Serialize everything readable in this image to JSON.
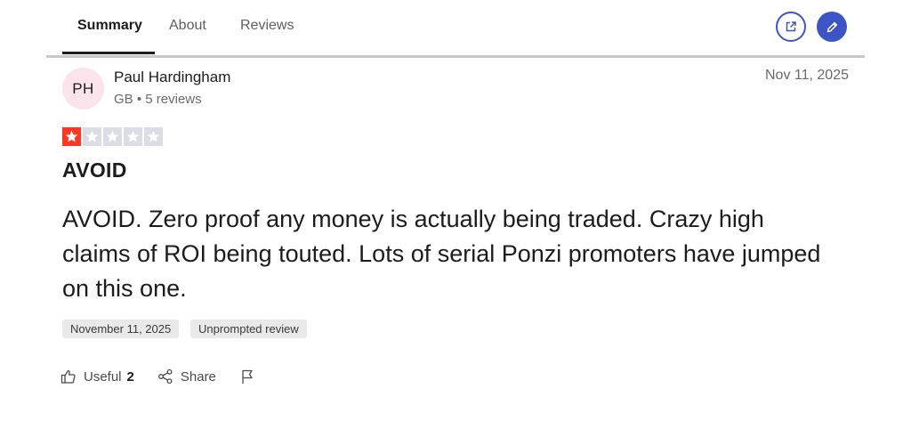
{
  "tabs": [
    {
      "label": "Summary",
      "active": true
    },
    {
      "label": "About",
      "active": false
    },
    {
      "label": "Reviews",
      "active": false
    }
  ],
  "header_actions": {
    "open_external_icon": "external-link-icon",
    "edit_icon": "pencil-icon",
    "accent_color": "#3d55c4"
  },
  "review": {
    "avatar_initials": "PH",
    "author": "Paul Hardingham",
    "author_meta": "GB • 5 reviews",
    "date": "Nov 11, 2025",
    "rating": 1,
    "rating_max": 5,
    "star_color_filled": "#ff3722",
    "star_color_empty": "#dcdce6",
    "title": "AVOID",
    "body": "AVOID. Zero proof any money is actually being traded. Crazy high claims of ROI being touted. Lots of serial Ponzi promoters have jumped on this one.",
    "tags": [
      "November 11, 2025",
      "Unprompted review"
    ],
    "actions": {
      "useful_label": "Useful",
      "useful_count": "2",
      "share_label": "Share",
      "report_icon": "flag-icon"
    }
  }
}
